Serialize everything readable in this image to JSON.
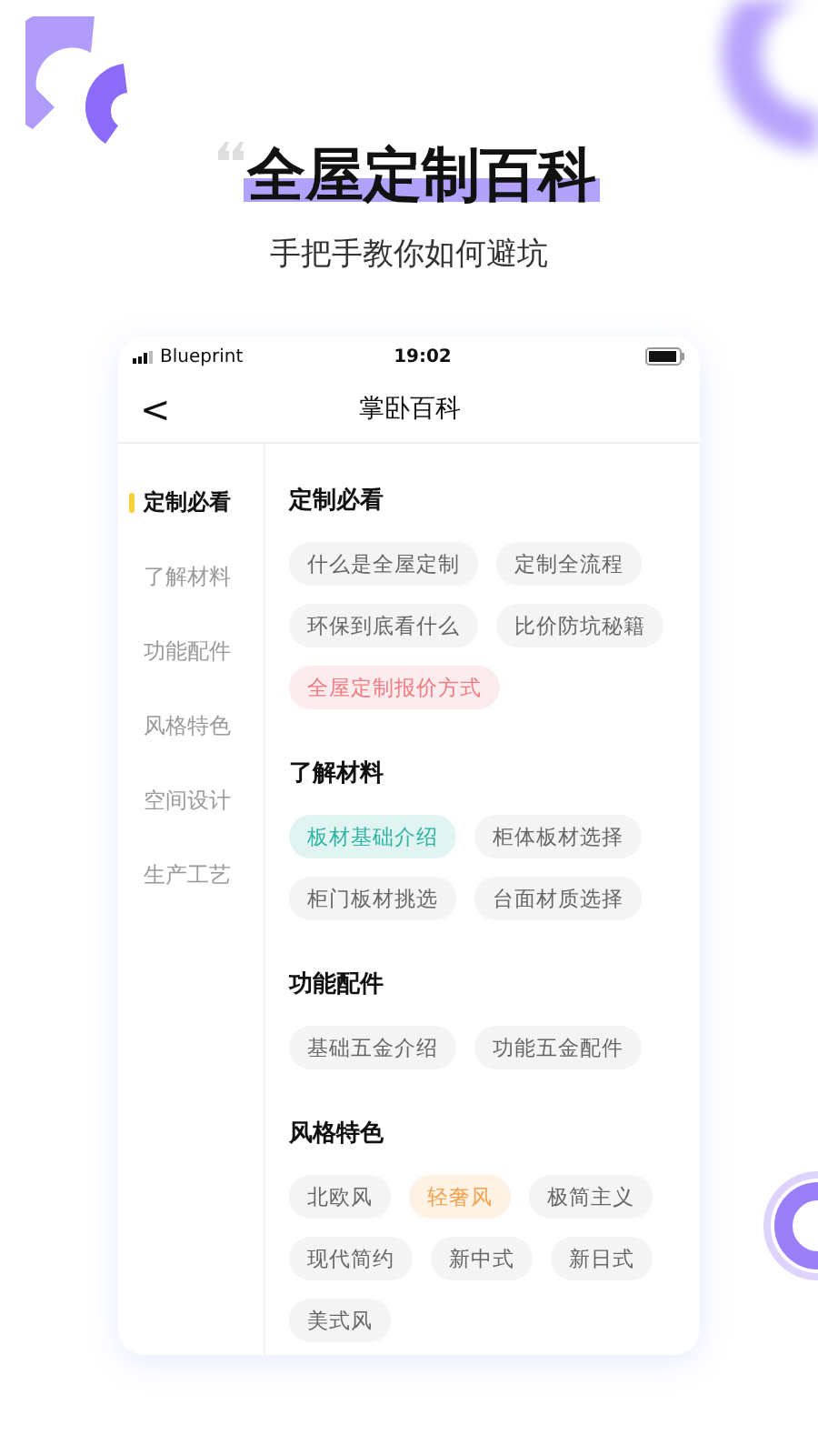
{
  "headline": {
    "title": "全屋定制百科",
    "subtitle": "手把手教你如何避坑"
  },
  "status_bar": {
    "carrier": "Blueprint",
    "time": "19:02"
  },
  "nav": {
    "back": "<",
    "title": "掌卧百科"
  },
  "sidebar": {
    "items": [
      {
        "label": "定制必看",
        "selected": true
      },
      {
        "label": "了解材料",
        "selected": false
      },
      {
        "label": "功能配件",
        "selected": false
      },
      {
        "label": "风格特色",
        "selected": false
      },
      {
        "label": "空间设计",
        "selected": false
      },
      {
        "label": "生产工艺",
        "selected": false
      }
    ]
  },
  "sections": [
    {
      "title": "定制必看",
      "tags": [
        {
          "label": "什么是全屋定制",
          "color": "#666666"
        },
        {
          "label": "定制全流程",
          "color": "#666666"
        },
        {
          "label": "环保到底看什么",
          "color": "#666666"
        },
        {
          "label": "比价防坑秘籍",
          "color": "#666666"
        },
        {
          "label": "全屋定制报价方式",
          "color": "#f07a82"
        }
      ]
    },
    {
      "title": "了解材料",
      "tags": [
        {
          "label": "板材基础介绍",
          "color": "#2db3a3"
        },
        {
          "label": "柜体板材选择",
          "color": "#666666"
        },
        {
          "label": "柜门板材挑选",
          "color": "#666666"
        },
        {
          "label": "台面材质选择",
          "color": "#666666"
        }
      ]
    },
    {
      "title": "功能配件",
      "tags": [
        {
          "label": "基础五金介绍",
          "color": "#666666"
        },
        {
          "label": "功能五金配件",
          "color": "#666666"
        }
      ]
    },
    {
      "title": "风格特色",
      "tags": [
        {
          "label": "北欧风",
          "color": "#666666"
        },
        {
          "label": "轻奢风",
          "color": "#f5a04a"
        },
        {
          "label": "极简主义",
          "color": "#666666"
        },
        {
          "label": "现代简约",
          "color": "#666666"
        },
        {
          "label": "新中式",
          "color": "#666666"
        },
        {
          "label": "新日式",
          "color": "#666666"
        },
        {
          "label": "美式风",
          "color": "#666666"
        }
      ]
    }
  ]
}
